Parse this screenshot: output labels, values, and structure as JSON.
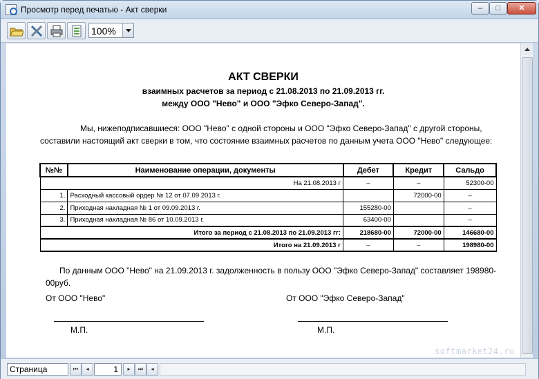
{
  "window": {
    "title": "Просмотр перед печатью - Акт сверки",
    "controls": {
      "minimize": "–",
      "maximize": "□",
      "close": "✕"
    }
  },
  "toolbar": {
    "buttons": [
      "open-folder-icon",
      "tools-icon",
      "printer-icon",
      "export-icon"
    ],
    "zoom_value": "100%"
  },
  "document": {
    "title": "АКТ СВЕРКИ",
    "subtitle1": "взаимных расчетов за период с 21.08.2013 по 21.09.2013 гг.",
    "subtitle2": "между ООО \"Нево\" и ООО \"Эфко Северо-Запад\".",
    "intro": "Мы, нижеподписавшиеся: ООО \"Нево\" с одной стороны и ООО \"Эфко Северо-Запад\" с другой стороны, составили настоящий акт сверки в том, что состояние взаимных расчетов по данным учета ООО \"Нево\" следующее:",
    "table": {
      "headers": [
        "№№",
        "Наименование операции, документы",
        "Дебет",
        "Кредит",
        "Сальдо"
      ],
      "opening": {
        "label": "На 21.08.2013 г",
        "debit": "–",
        "credit": "–",
        "balance": "52300-00"
      },
      "rows": [
        {
          "num": "1.",
          "name": "Расходный кассовый ордер № 12 от 07.09.2013 г.",
          "debit": "",
          "credit": "72000-00",
          "balance": "–"
        },
        {
          "num": "2.",
          "name": "Приходная накладная № 1 от 09.09.2013 г.",
          "debit": "155280-00",
          "credit": "",
          "balance": "–"
        },
        {
          "num": "3.",
          "name": "Приходная накладная № 86 от 10.09.2013 г.",
          "debit": "63400-00",
          "credit": "",
          "balance": "–"
        }
      ],
      "period_total": {
        "label": "Итого за период с 21.08.2013 по 21.09.2013 гг:",
        "debit": "218680-00",
        "credit": "72000-00",
        "balance": "146680-00"
      },
      "closing": {
        "label": "Итого на 21.09.2013 г",
        "debit": "–",
        "credit": "–",
        "balance": "198980-00"
      }
    },
    "summary": "По данным ООО \"Нево\" на 21.09.2013 г. задолженность в пользу ООО \"Эфко Северо-Запад\" составляет 198980-00руб.",
    "from_left": "От ООО \"Нево\"",
    "from_right": "От ООО \"Эфко Северо-Запад\"",
    "stamp_left": "М.П.",
    "stamp_right": "М.П."
  },
  "statusbar": {
    "page_label": "Страница",
    "page_number": "1",
    "nav": {
      "first": "⏮",
      "prev": "◂",
      "next": "▸",
      "last": "⏭"
    }
  },
  "watermark": "softmarket24.ru"
}
